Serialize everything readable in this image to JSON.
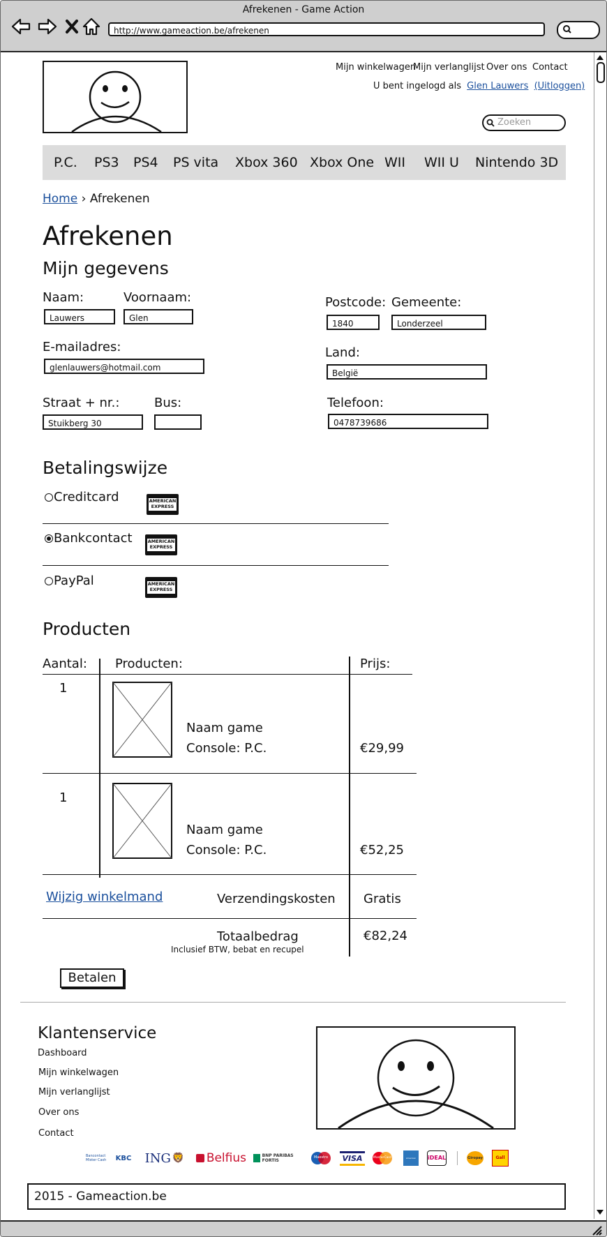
{
  "browser": {
    "window_title": "Afrekenen - Game Action",
    "url": "http://www.gameaction.be/afrekenen"
  },
  "header": {
    "top_links": [
      "Mijn winkelwagen",
      "Mijn verlanglijst",
      "Over ons",
      "Contact"
    ],
    "login_prefix": "U bent ingelogd als",
    "user_name": "Glen Lauwers",
    "logout": "(Uitloggen)",
    "search_placeholder": "Zoeken"
  },
  "menu": [
    "P.C.",
    "PS3",
    "PS4",
    "PS vita",
    "Xbox 360",
    "Xbox One",
    "WII",
    "WII U",
    "Nintendo 3D"
  ],
  "breadcrumb": {
    "home": "Home",
    "current": "Afrekenen"
  },
  "page_title": "Afrekenen",
  "details": {
    "heading": "Mijn gegevens",
    "naam_label": "Naam:",
    "naam": "Lauwers",
    "voornaam_label": "Voornaam:",
    "voornaam": "Glen",
    "email_label": "E-mailadres:",
    "email": "glenlauwers@hotmail.com",
    "straat_label": "Straat + nr.:",
    "straat": "Stuikberg 30",
    "bus_label": "Bus:",
    "bus": "",
    "postcode_label": "Postcode:",
    "postcode": "1840",
    "gemeente_label": "Gemeente:",
    "gemeente": "Londerzeel",
    "land_label": "Land:",
    "land": "België",
    "telefoon_label": "Telefoon:",
    "telefoon": "0478739686"
  },
  "payment": {
    "heading": "Betalingswijze",
    "options": [
      {
        "label": "Creditcard",
        "selected": false
      },
      {
        "label": "Bankcontact",
        "selected": true
      },
      {
        "label": "PayPal",
        "selected": false
      }
    ],
    "card_logo_line1": "AMERICAN",
    "card_logo_line2": "EXPRESS"
  },
  "products": {
    "heading": "Producten",
    "columns": [
      "Aantal:",
      "Producten:",
      "Prijs:"
    ],
    "rows": [
      {
        "qty": "1",
        "name": "Naam game",
        "console": "Console: P.C.",
        "price": "€29,99"
      },
      {
        "qty": "1",
        "name": "Naam game",
        "console": "Console: P.C.",
        "price": "€52,25"
      }
    ],
    "edit_cart": "Wijzig winkelmand",
    "shipping_label": "Verzendingskosten",
    "shipping_value": "Gratis",
    "total_label": "Totaalbedrag",
    "total_note": "Inclusief BTW, bebat en recupel",
    "total_value": "€82,24",
    "pay_button": "Betalen"
  },
  "footer": {
    "heading": "Klantenservice",
    "links": [
      "Dashboard",
      "Mijn winkelwagen",
      "Mijn verlanglijst",
      "Over ons",
      "Contact"
    ],
    "payment_logos": [
      "Bancontact Mister Cash",
      "KBC",
      "ING",
      "Belfius",
      "BNP PARIBAS FORTIS",
      "Maestro",
      "VISA",
      "MasterCard",
      "American Express",
      "iDEAL",
      "Giropay",
      "Gall"
    ],
    "copyright": "2015 - Gameaction.be"
  }
}
